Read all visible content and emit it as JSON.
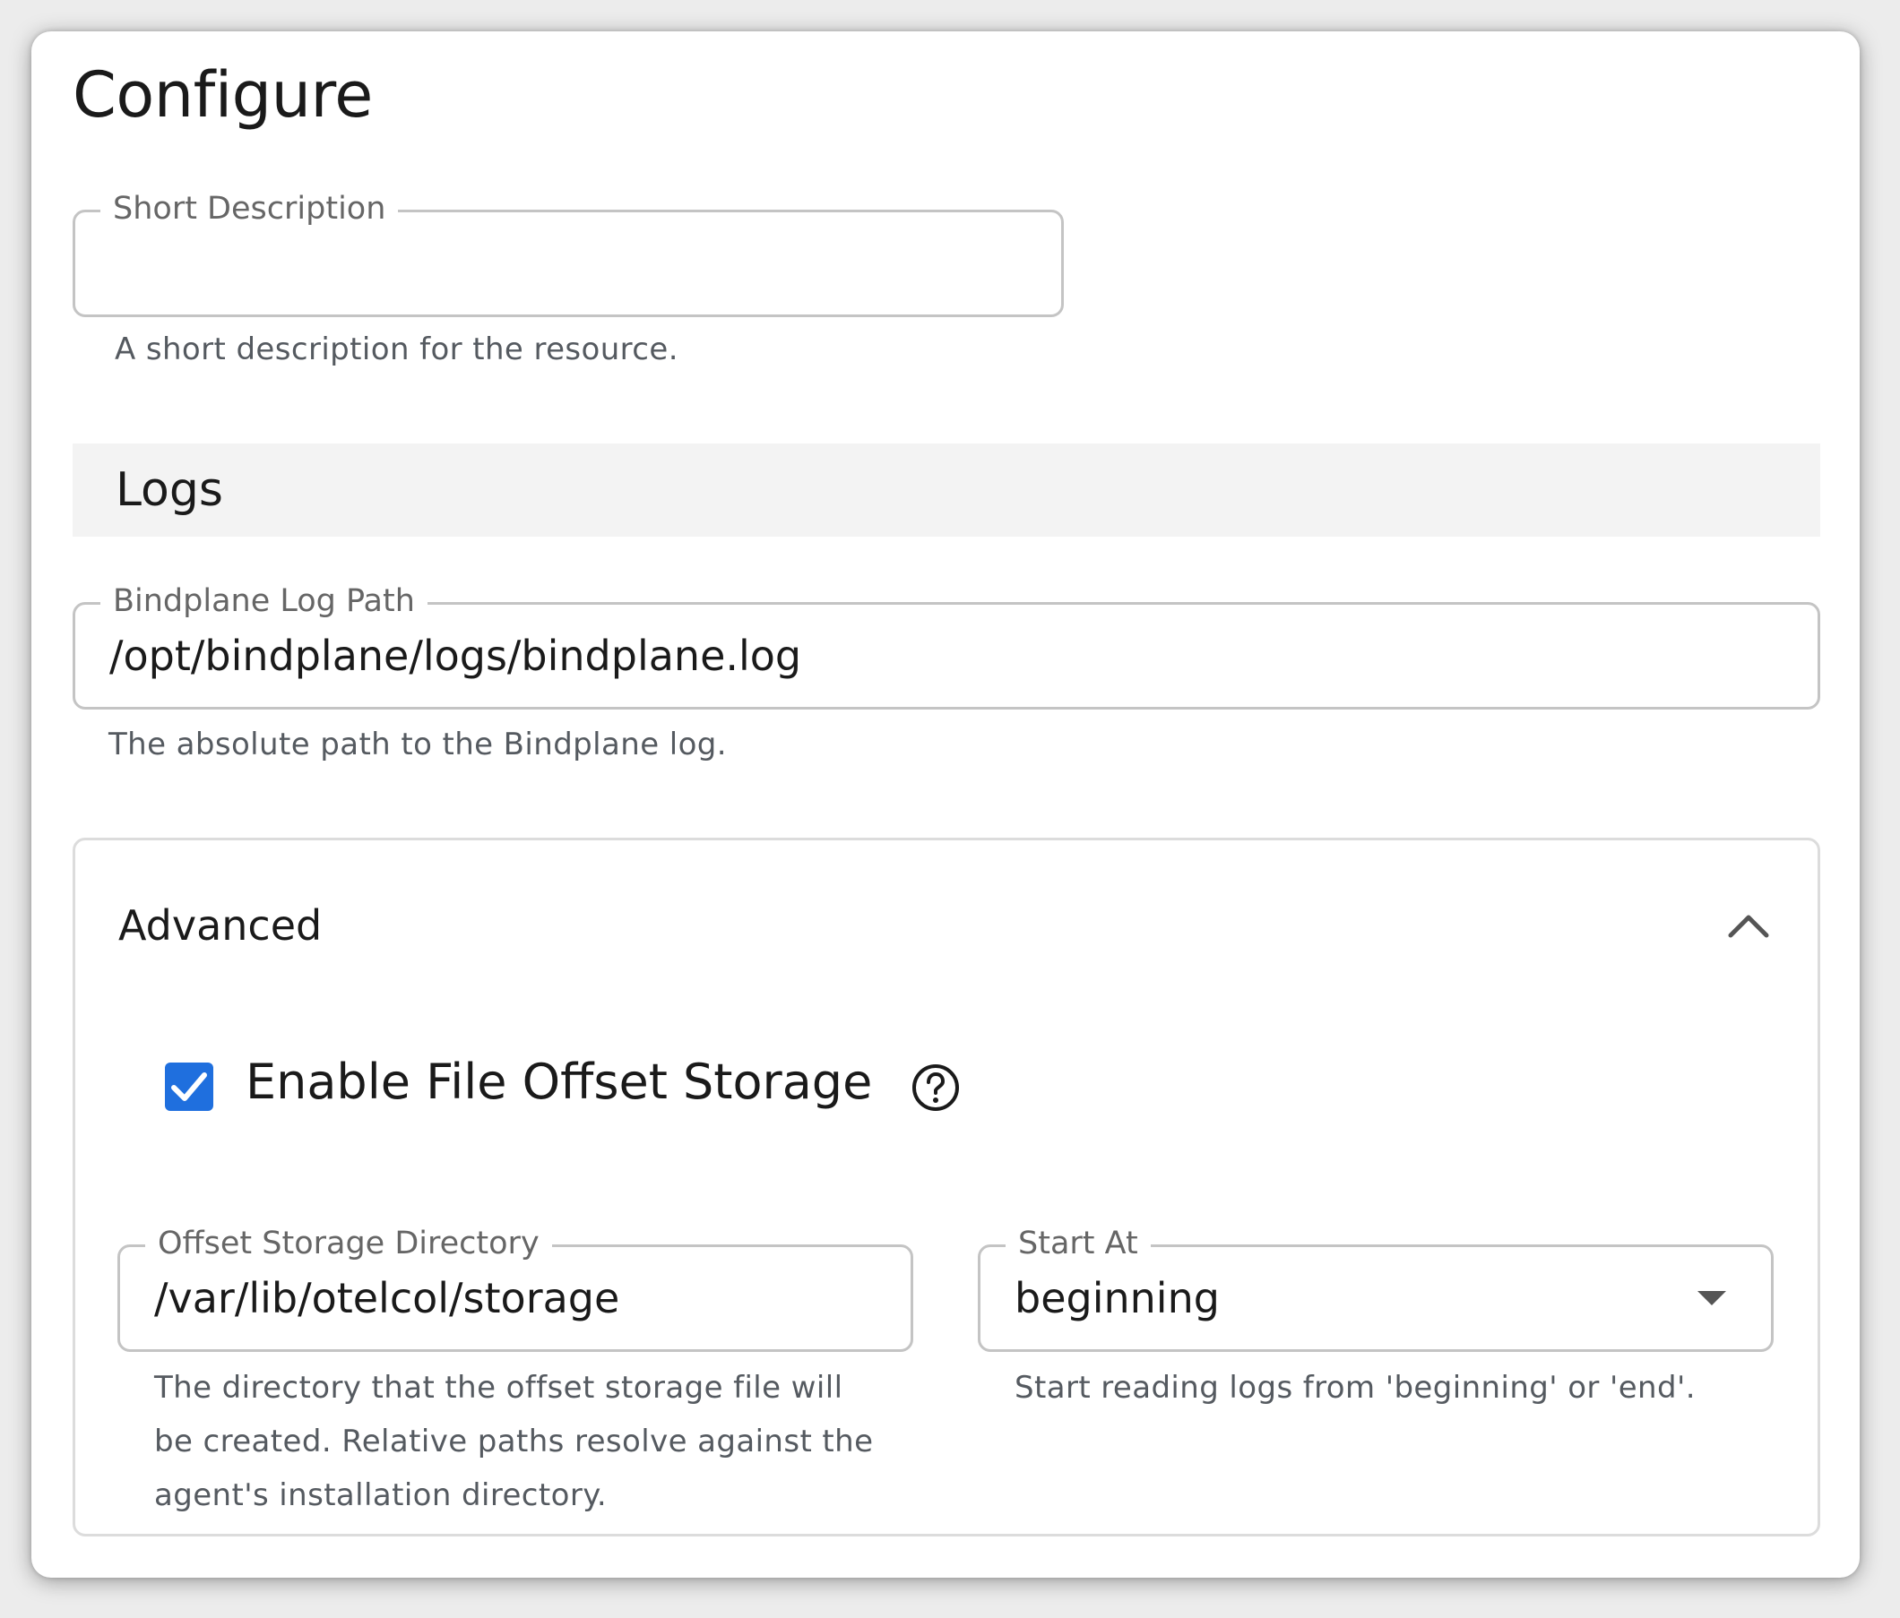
{
  "title": "Configure",
  "short_description": {
    "label": "Short Description",
    "value": "",
    "helper": "A short description for the resource."
  },
  "logs_section": {
    "title": "Logs"
  },
  "log_path": {
    "label": "Bindplane Log Path",
    "value": "/opt/bindplane/logs/bindplane.log",
    "helper": "The absolute path to the Bindplane log."
  },
  "advanced": {
    "title": "Advanced",
    "expanded": true,
    "enable_offset_storage": {
      "label": "Enable File Offset Storage",
      "checked": true
    },
    "offset_directory": {
      "label": "Offset Storage Directory",
      "value": "/var/lib/otelcol/storage",
      "helper_lines": [
        "The directory that the offset storage file will",
        "be created. Relative paths resolve against the",
        "agent's installation directory."
      ]
    },
    "start_at": {
      "label": "Start At",
      "value": "beginning",
      "helper": "Start reading logs from 'beginning' or 'end'."
    }
  },
  "colors": {
    "accent": "#1f6fde",
    "border": "#c4c4c4",
    "section_bg": "#f3f3f3"
  },
  "icons": [
    "chevron-up-icon",
    "check-icon",
    "help-circle-icon",
    "dropdown-arrow-icon"
  ]
}
